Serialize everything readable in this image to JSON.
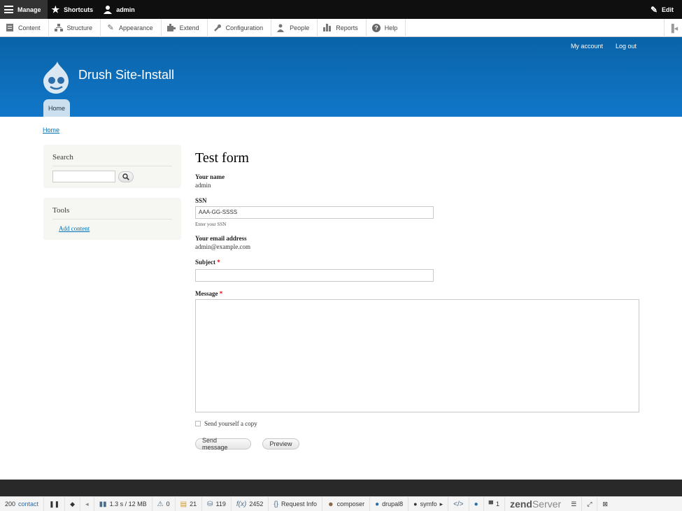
{
  "admin_toolbar": {
    "manage": "Manage",
    "shortcuts": "Shortcuts",
    "user": "admin",
    "edit": "Edit"
  },
  "tray": {
    "items": [
      {
        "label": "Content",
        "icon": "content-icon"
      },
      {
        "label": "Structure",
        "icon": "structure-icon"
      },
      {
        "label": "Appearance",
        "icon": "appearance-icon"
      },
      {
        "label": "Extend",
        "icon": "extend-icon"
      },
      {
        "label": "Configuration",
        "icon": "configuration-icon"
      },
      {
        "label": "People",
        "icon": "people-icon"
      },
      {
        "label": "Reports",
        "icon": "reports-icon"
      },
      {
        "label": "Help",
        "icon": "help-icon"
      }
    ]
  },
  "header": {
    "my_account": "My account",
    "log_out": "Log out",
    "site_name": "Drush Site-Install",
    "home_tab": "Home"
  },
  "breadcrumb": "Home",
  "sidebar": {
    "search_title": "Search",
    "tools_title": "Tools",
    "add_content": "Add content"
  },
  "form": {
    "title": "Test form",
    "your_name_label": "Your name",
    "your_name_value": "admin",
    "ssn_label": "SSN",
    "ssn_value": "AAA-GG-SSSS",
    "ssn_desc": "Enter your SSN",
    "email_label": "Your email address",
    "email_value": "admin@example.com",
    "subject_label": "Subject",
    "message_label": "Message",
    "required_marker": "*",
    "copy_label": "Send yourself a copy",
    "send_button": "Send message",
    "preview_button": "Preview"
  },
  "debug_toolbar": {
    "status": "200",
    "route": "contact",
    "time_memory": "1.3 s / 12 MB",
    "warnings": "0",
    "forms": "21",
    "queries": "119",
    "functions": "2452",
    "request_info": "Request Info",
    "composer": "composer",
    "drupal": "drupal8",
    "symfony": "symfo",
    "comments": "1",
    "zend_a": "zend",
    "zend_b": "Server"
  }
}
